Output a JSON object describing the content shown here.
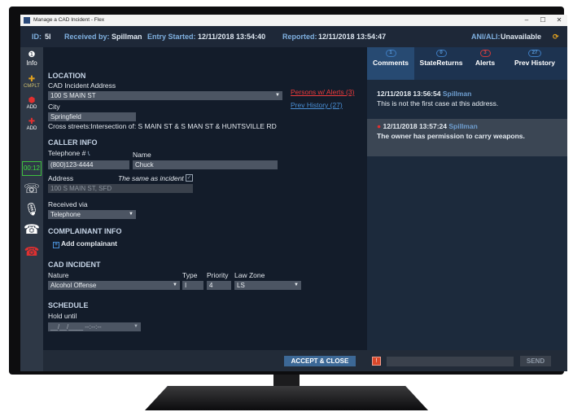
{
  "window": {
    "title": "Manage a CAD Incident - Flex",
    "minimize": "–",
    "maximize": "☐",
    "close": "✕"
  },
  "infobar": {
    "id_label": "ID:",
    "id_value": "5I",
    "received_label": "Received by:",
    "received_value": "Spillman",
    "entry_label": "Entry Started:",
    "entry_value": "12/11/2018 13:54:40",
    "reported_label": "Reported:",
    "reported_value": "12/11/2018 13:54:47",
    "ani_label": "ANI/ALI:",
    "ani_value": "Unavailable"
  },
  "sidebar": {
    "info_label": "Info",
    "cmplt_label": "CMPLT",
    "add1_label": "ADD",
    "add2_label": "ADD",
    "timer": "00:12"
  },
  "location": {
    "section": "LOCATION",
    "address_label": "CAD Incident Address",
    "address_value": "100 S MAIN ST",
    "city_label": "City",
    "city_value": "Springfield",
    "cross_streets": "Cross streets:Intersection of: S MAIN ST & S MAN ST & HUNTSVILLE RD",
    "persons_alerts_link": "Persons w/ Alerts (3)",
    "prev_history_link": "Prev History (27)"
  },
  "caller": {
    "section": "CALLER INFO",
    "telephone_label": "Telephone #",
    "telephone_value": "(800)123-4444",
    "name_label": "Name",
    "name_value": "Chuck",
    "address_label": "Address",
    "same_as_incident_label": "The same as incident",
    "address_value": "100 S MAIN ST, SFD",
    "received_via_label": "Received via",
    "received_via_value": "Telephone"
  },
  "complainant": {
    "section": "COMPLAINANT INFO",
    "add_label": "Add complainant"
  },
  "incident": {
    "section": "CAD INCIDENT",
    "nature_label": "Nature",
    "nature_value": "Alcohol Offense",
    "type_label": "Type",
    "type_value": "I",
    "priority_label": "Priority",
    "priority_value": "4",
    "lawzone_label": "Law Zone",
    "lawzone_value": "LS"
  },
  "schedule": {
    "section": "SCHEDULE",
    "hold_label": "Hold until",
    "hold_value": "__/__/____ --:--:--"
  },
  "footer": {
    "accept_close": "ACCEPT & CLOSE"
  },
  "tabs": [
    {
      "label": "Comments",
      "badge": "1"
    },
    {
      "label": "StateReturns",
      "badge": "0"
    },
    {
      "label": "Alerts",
      "badge": "3"
    },
    {
      "label": "Prev History",
      "badge": "27"
    }
  ],
  "messages": [
    {
      "timestamp": "12/11/2018 13:56:54",
      "author": "Spillman",
      "text": "This is not the first case at this address."
    },
    {
      "timestamp": "12/11/2018 13:57:24",
      "author": "Spillman",
      "text": "The owner has permission to carry weapons."
    }
  ],
  "right_footer": {
    "send": "SEND"
  }
}
